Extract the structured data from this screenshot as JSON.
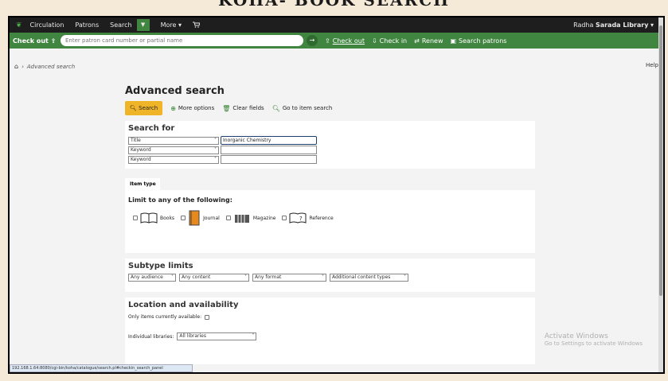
{
  "banner": "KOHA- BOOK SEARCH",
  "topnav": {
    "items": [
      "Circulation",
      "Patrons",
      "Search",
      "More"
    ],
    "more_caret": "▾",
    "cart_icon": "cart-icon",
    "user": "Radha",
    "library": "Sarada Library",
    "user_caret": "▾"
  },
  "checkout_bar": {
    "label": "Check out",
    "placeholder": "Enter patron card number or partial name",
    "actions": [
      "Check out",
      "Check in",
      "Renew",
      "Search patrons"
    ]
  },
  "breadcrumb": {
    "current": "Advanced search"
  },
  "help": "Help",
  "page": {
    "title": "Advanced search",
    "toolbar": {
      "search": "Search",
      "more_options": "More options",
      "clear_fields": "Clear fields",
      "item_search": "Go to item search"
    }
  },
  "search_for": {
    "heading": "Search for",
    "rows": [
      {
        "index": "Title",
        "value": "Inorganic Chemistry"
      },
      {
        "index": "Keyword",
        "value": ""
      },
      {
        "index": "Keyword",
        "value": ""
      }
    ]
  },
  "item_type": {
    "tab": "Item type",
    "limit_heading": "Limit to any of the following:",
    "types": [
      "Books",
      "Journal",
      "Magazine",
      "Reference"
    ]
  },
  "subtype": {
    "heading": "Subtype limits",
    "audience": "Any audience",
    "content": "Any content",
    "format": "Any format",
    "additional": "Additional content types"
  },
  "location": {
    "heading": "Location and availability",
    "available_label": "Only items currently available:",
    "libraries_label": "Individual libraries:",
    "libraries_value": "All libraries"
  },
  "watermark": {
    "title": "Activate Windows",
    "subtitle": "Go to Settings to activate Windows"
  },
  "status_url": "192.168.1.64:8080/cgi-bin/koha/catalogue/search.pl#checkin_search_panel"
}
